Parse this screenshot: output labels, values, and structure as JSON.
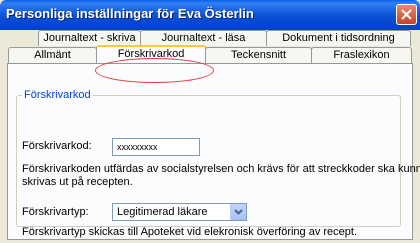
{
  "window": {
    "title": "Personliga inställningar för Eva Österlin"
  },
  "tabs_back": [
    "Journaltext - skriva",
    "Journaltext - läsa",
    "Dokument i tidsordning"
  ],
  "tabs_front": [
    "Allmänt",
    "Förskrivarkod",
    "Teckensnitt",
    "Fraslexikon"
  ],
  "active_tab": "Förskrivarkod",
  "group": {
    "legend": "Förskrivarkod",
    "code_label": "Förskrivarkod:",
    "code_value": "xxxxxxxxx",
    "info_text_1": "Förskrivarkoden utfärdas av socialstyrelsen och krävs för att streckkoder ska kunna",
    "info_text_2": "skrivas ut på recepten.",
    "type_label": "Förskrivartyp:",
    "type_value": "Legitimerad läkare",
    "type_info": "Förskrivartyp skickas till Apoteket vid elekronisk överföring av recept."
  },
  "colors": {
    "titlebar": "#0a4fd6",
    "dialog_bg": "#ece9d8",
    "panel_bg": "#fcfcfe",
    "legend_text": "#0046d5",
    "annotation_circle": "#e23a3a"
  }
}
